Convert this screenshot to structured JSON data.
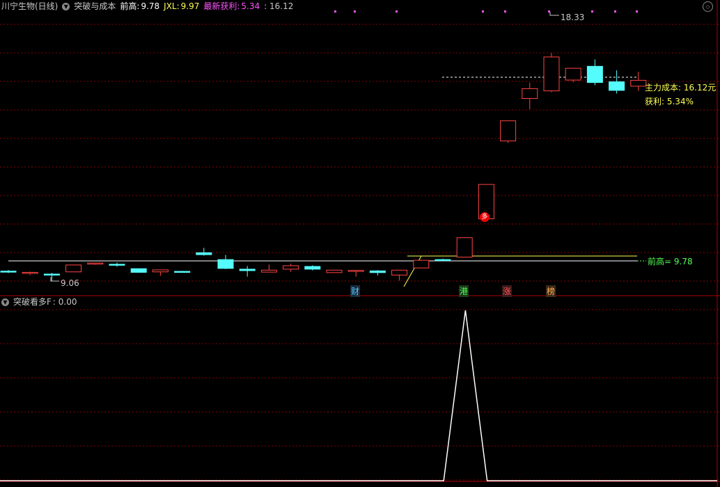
{
  "header": {
    "stock_name": "川宁生物(日线)",
    "indicator_name": "突破与成本",
    "prev_high_label": "前高:",
    "prev_high_value": "9.78",
    "jxl_label": "JXL:",
    "jxl_value": "9.97",
    "latest_profit_label": "最新获利:",
    "latest_profit_value": "5.34",
    "extra_value": ": 16.12"
  },
  "sub_header": {
    "indicator_name": "突破看多F",
    "value": ": 0.00"
  },
  "annotations": {
    "high_price": "18.33",
    "low_price": "9.06",
    "main_cost": "主力成本: 16.12元",
    "profit": "获利: 5.34%",
    "prev_high_line": "前高= 9.78",
    "buy_signal": "多",
    "tag_cai": "财",
    "tag_gang": "港",
    "tag_zhang": "涨",
    "tag_bang": "榜"
  },
  "colors": {
    "up": "#ff4444",
    "down": "#54fcfc",
    "grid": "#8b0000",
    "yellow": "#ffff54",
    "magenta": "#ff54ff",
    "green": "#54ff54",
    "white": "#ffffff"
  },
  "chart_data": {
    "type": "candlestick",
    "ohlc": [
      {
        "o": 9.45,
        "h": 9.5,
        "l": 9.37,
        "c": 9.42
      },
      {
        "o": 9.36,
        "h": 9.43,
        "l": 9.29,
        "c": 9.4
      },
      {
        "o": 9.33,
        "h": 9.38,
        "l": 9.06,
        "c": 9.3
      },
      {
        "o": 9.42,
        "h": 9.7,
        "l": 9.42,
        "c": 9.7
      },
      {
        "o": 9.74,
        "h": 9.78,
        "l": 9.71,
        "c": 9.78
      },
      {
        "o": 9.73,
        "h": 9.8,
        "l": 9.63,
        "c": 9.72
      },
      {
        "o": 9.55,
        "h": 9.56,
        "l": 9.38,
        "c": 9.4
      },
      {
        "o": 9.42,
        "h": 9.51,
        "l": 9.26,
        "c": 9.5
      },
      {
        "o": 9.44,
        "h": 9.46,
        "l": 9.39,
        "c": 9.41
      },
      {
        "o": 10.2,
        "h": 10.4,
        "l": 10.08,
        "c": 10.12
      },
      {
        "o": 9.92,
        "h": 10.11,
        "l": 9.53,
        "c": 9.56
      },
      {
        "o": 9.53,
        "h": 9.66,
        "l": 9.23,
        "c": 9.47
      },
      {
        "o": 9.41,
        "h": 9.72,
        "l": 9.4,
        "c": 9.49
      },
      {
        "o": 9.53,
        "h": 9.75,
        "l": 9.42,
        "c": 9.67
      },
      {
        "o": 9.64,
        "h": 9.69,
        "l": 9.48,
        "c": 9.53
      },
      {
        "o": 9.39,
        "h": 9.47,
        "l": 9.38,
        "c": 9.49
      },
      {
        "o": 9.48,
        "h": 9.48,
        "l": 9.23,
        "c": 9.48
      },
      {
        "o": 9.46,
        "h": 9.49,
        "l": 9.27,
        "c": 9.39
      },
      {
        "o": 9.29,
        "h": 9.5,
        "l": 9.06,
        "c": 9.49
      },
      {
        "o": 9.58,
        "h": 9.92,
        "l": 9.56,
        "c": 9.89
      },
      {
        "o": 9.92,
        "h": 9.96,
        "l": 9.89,
        "c": 9.91
      },
      {
        "o": 10.02,
        "h": 10.81,
        "l": 10.02,
        "c": 10.81
      },
      {
        "o": 11.58,
        "h": 12.98,
        "l": 11.58,
        "c": 12.98
      },
      {
        "o": 14.75,
        "h": 15.58,
        "l": 14.68,
        "c": 15.57
      },
      {
        "o": 16.48,
        "h": 17.12,
        "l": 16.05,
        "c": 16.88
      },
      {
        "o": 16.79,
        "h": 18.33,
        "l": 16.74,
        "c": 18.17
      },
      {
        "o": 17.23,
        "h": 17.7,
        "l": 17.14,
        "c": 17.71
      },
      {
        "o": 17.79,
        "h": 18.07,
        "l": 17.02,
        "c": 17.13
      },
      {
        "o": 17.16,
        "h": 17.63,
        "l": 16.68,
        "c": 16.81
      },
      {
        "o": 16.98,
        "h": 17.57,
        "l": 16.78,
        "c": 17.22
      }
    ],
    "prev_high": 9.78,
    "main_cost": 16.12,
    "sub_series": [
      0,
      0,
      0,
      0,
      0,
      0,
      0,
      0,
      0,
      0,
      0,
      0,
      0,
      0,
      0,
      0,
      0,
      0,
      0,
      0,
      0,
      0,
      1,
      0,
      0,
      0,
      0,
      0,
      0,
      0
    ]
  }
}
